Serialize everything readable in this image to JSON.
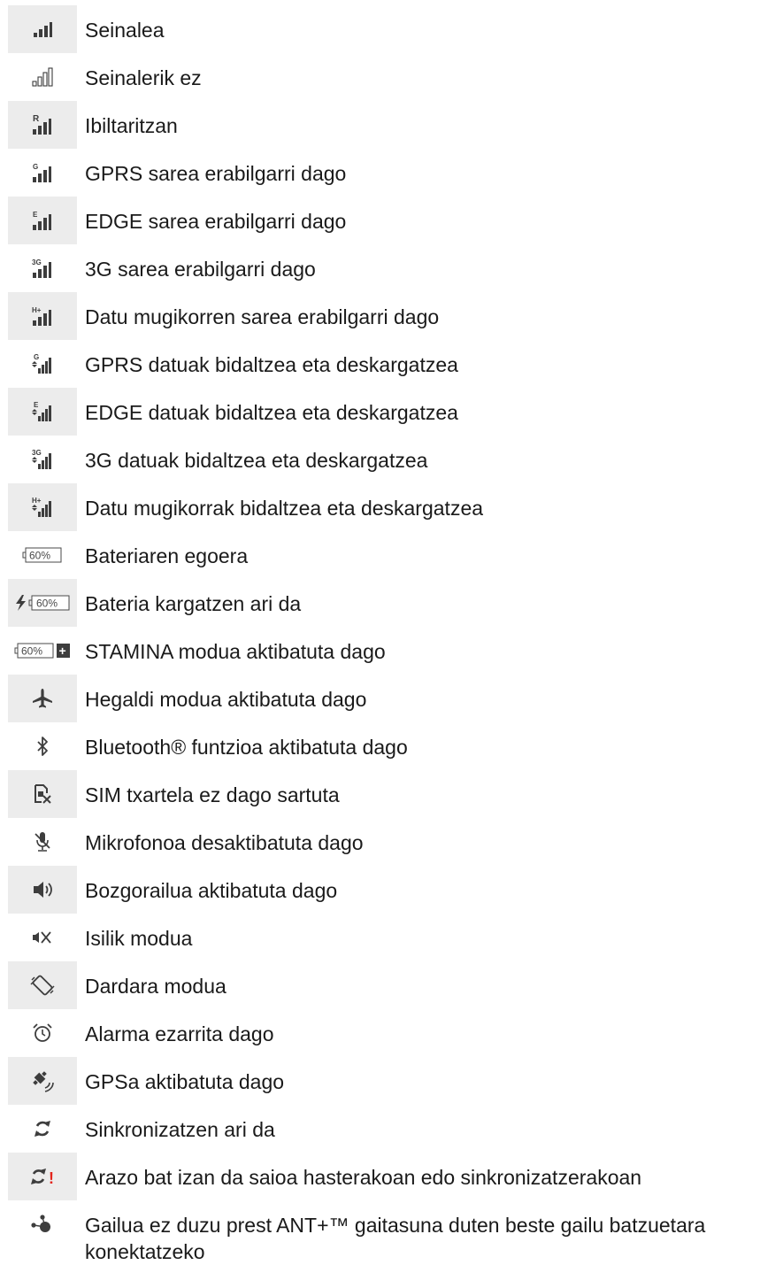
{
  "items": [
    {
      "icon": "signal-strength-icon",
      "label": "Seinalea"
    },
    {
      "icon": "no-signal-icon",
      "label": "Seinalerik ez"
    },
    {
      "icon": "roaming-icon",
      "label": "Ibiltaritzan"
    },
    {
      "icon": "gprs-network-icon",
      "label": "GPRS sarea erabilgarri dago"
    },
    {
      "icon": "edge-network-icon",
      "label": "EDGE sarea erabilgarri dago"
    },
    {
      "icon": "3g-network-icon",
      "label": "3G sarea erabilgarri dago"
    },
    {
      "icon": "mobile-data-network-icon",
      "label": "Datu mugikorren sarea erabilgarri dago"
    },
    {
      "icon": "gprs-data-transfer-icon",
      "label": "GPRS datuak bidaltzea eta deskargatzea"
    },
    {
      "icon": "edge-data-transfer-icon",
      "label": "EDGE datuak bidaltzea eta deskargatzea"
    },
    {
      "icon": "3g-data-transfer-icon",
      "label": "3G datuak bidaltzea eta deskargatzea"
    },
    {
      "icon": "mobile-data-transfer-icon",
      "label": "Datu mugikorrak bidaltzea eta deskargatzea"
    },
    {
      "icon": "battery-status-icon",
      "label": "Bateriaren egoera"
    },
    {
      "icon": "battery-charging-icon",
      "label": "Bateria kargatzen ari da"
    },
    {
      "icon": "stamina-mode-icon",
      "label": "STAMINA modua aktibatuta dago"
    },
    {
      "icon": "airplane-mode-icon",
      "label": "Hegaldi modua aktibatuta dago"
    },
    {
      "icon": "bluetooth-icon",
      "label": "Bluetooth® funtzioa aktibatuta dago"
    },
    {
      "icon": "no-sim-card-icon",
      "label": "SIM txartela ez dago sartuta"
    },
    {
      "icon": "microphone-muted-icon",
      "label": "Mikrofonoa desaktibatuta dago"
    },
    {
      "icon": "speaker-on-icon",
      "label": "Bozgorailua aktibatuta dago"
    },
    {
      "icon": "silent-mode-icon",
      "label": "Isilik modua"
    },
    {
      "icon": "vibrate-mode-icon",
      "label": "Dardara modua"
    },
    {
      "icon": "alarm-clock-icon",
      "label": "Alarma ezarrita dago"
    },
    {
      "icon": "gps-satellite-icon",
      "label": "GPSa aktibatuta dago"
    },
    {
      "icon": "sync-icon",
      "label": "Sinkronizatzen ari da"
    },
    {
      "icon": "sync-error-icon",
      "label": "Arazo bat izan da saioa hasterakoan edo sinkronizatzerakoan"
    },
    {
      "icon": "ant-plus-icon",
      "label": "Gailua ez duzu prest ANT+™ gaitasuna duten beste gailu batzuetara konektatzeko"
    }
  ],
  "icon_text": {
    "roaming": "R",
    "gprs": "G",
    "edge": "E",
    "threeg": "3G",
    "hplus": "H+",
    "battery_percent": "60%",
    "stamina_plus": "+",
    "sync_error_mark": "!"
  },
  "colors": {
    "icon_tile": "#ececec",
    "icon_glyph": "#3d3d3d",
    "error_red": "#e3241b"
  }
}
